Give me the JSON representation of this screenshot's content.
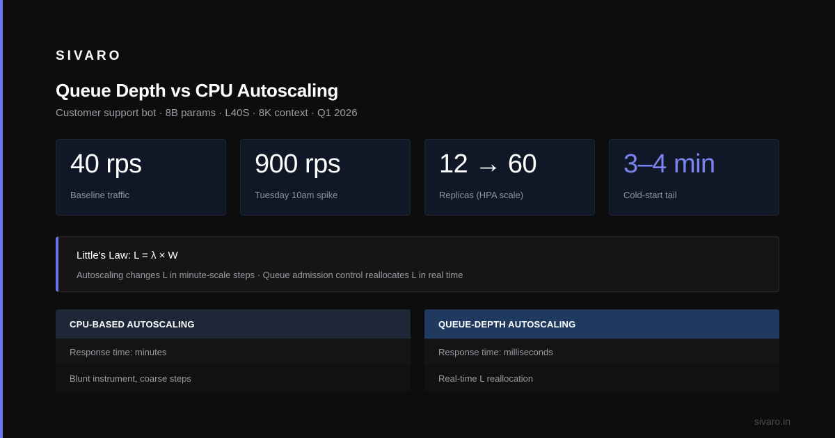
{
  "brand": "SIVARO",
  "title": "Queue Depth vs CPU Autoscaling",
  "subtitle": "Customer support bot · 8B params · L40S · 8K context · Q1 2026",
  "stats": [
    {
      "value": "40 rps",
      "label": "Baseline traffic"
    },
    {
      "value": "900 rps",
      "label": "Tuesday 10am spike"
    },
    {
      "value": "12 → 60",
      "label": "Replicas (HPA scale)"
    },
    {
      "value": "3–4 min",
      "label": "Cold-start tail"
    }
  ],
  "law": {
    "title": "Little's Law: L = λ × W",
    "description": "Autoscaling changes L in minute-scale steps · Queue admission control reallocates L in real time"
  },
  "comparison": {
    "cpu": {
      "header": "CPU-BASED AUTOSCALING",
      "rows": [
        "Response time: minutes",
        "Blunt instrument, coarse steps"
      ]
    },
    "queue": {
      "header": "QUEUE-DEPTH AUTOSCALING",
      "rows": [
        "Response time: milliseconds",
        "Real-time L reallocation"
      ]
    }
  },
  "footer": "sivaro.in",
  "colors": {
    "accent": "#6b74e8",
    "accent_text": "#7c83f0",
    "background": "#0d0d0d",
    "card": "#101828",
    "cpu_header": "#1e2738",
    "queue_header": "#1f3a5e"
  }
}
